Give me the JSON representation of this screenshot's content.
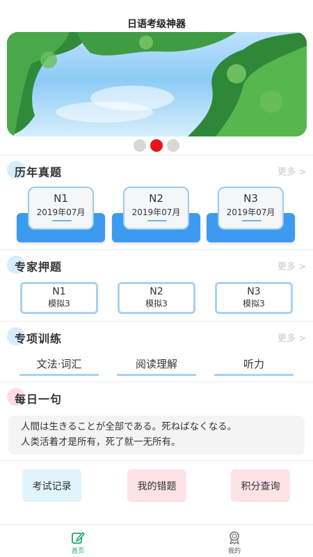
{
  "app": {
    "title": "日语考级神器"
  },
  "banner": {
    "dots": 3,
    "active_dot": 1
  },
  "past_exams": {
    "title": "历年真题",
    "more": "更多 >",
    "cards": [
      {
        "level": "N1",
        "date": "2019年07月"
      },
      {
        "level": "N2",
        "date": "2019年07月"
      },
      {
        "level": "N3",
        "date": "2019年07月"
      }
    ]
  },
  "expert": {
    "title": "专家押题",
    "more": "更多 >",
    "cards": [
      {
        "level": "N1",
        "sub": "模拟3"
      },
      {
        "level": "N2",
        "sub": "模拟3"
      },
      {
        "level": "N3",
        "sub": "模拟3"
      }
    ]
  },
  "training": {
    "title": "专项训练",
    "more": "更多 >",
    "items": [
      "文法·词汇",
      "阅读理解",
      "听力"
    ]
  },
  "daily": {
    "title": "每日一句",
    "jp": "人間は生きることが全部である。死ねばなくなる。",
    "cn": "人类活着才是所有，死了就一无所有。"
  },
  "actions": [
    "考试记录",
    "我的错题",
    "积分查询"
  ],
  "tabbar": {
    "home": "首页",
    "mine": "我的"
  },
  "colors": {
    "accent_blue": "#3d9bef",
    "dot_active": "#e8161b",
    "home_tab": "#1aa66c",
    "action_blue_bg": "#e0f4fc",
    "action_pink_bg": "#fde2e6"
  },
  "icons": {
    "home": "edit-icon",
    "mine": "medal-icon"
  }
}
